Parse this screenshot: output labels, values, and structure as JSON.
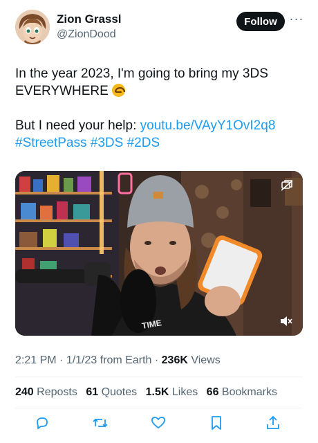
{
  "author": {
    "name": "Zion Grassl",
    "handle": "@ZionDood",
    "follow_label": "Follow",
    "more_icon": "more-horizontal-icon"
  },
  "tweet": {
    "line1": "In the year 2023, I'm going to bring my 3DS EVERYWHERE",
    "emoji": "upside-down-face",
    "line2_prefix": "But I need your help: ",
    "link": "youtu.be/VAyY1OvI2q8",
    "hashtags": [
      "#StreetPass",
      "#3DS",
      "#2DS"
    ]
  },
  "media": {
    "type": "video",
    "overlay_icons": [
      "sensitive-media-icon",
      "mute-icon"
    ]
  },
  "meta": {
    "time": "2:21 PM",
    "date": "1/1/23",
    "source": "from Earth",
    "views_count": "236K",
    "views_label": "Views"
  },
  "stats": [
    {
      "count": "240",
      "label": "Reposts"
    },
    {
      "count": "61",
      "label": "Quotes"
    },
    {
      "count": "1.5K",
      "label": "Likes"
    },
    {
      "count": "66",
      "label": "Bookmarks"
    }
  ],
  "actions": [
    "reply-icon",
    "repost-icon",
    "like-icon",
    "bookmark-icon",
    "share-icon"
  ],
  "colors": {
    "text": "#0f1419",
    "muted": "#536471",
    "link": "#1d9bf0",
    "button": "#0f1419"
  }
}
